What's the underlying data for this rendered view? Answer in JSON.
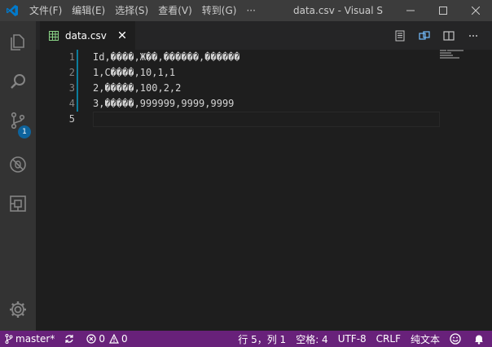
{
  "titlebar": {
    "menu": [
      "文件(F)",
      "编辑(E)",
      "选择(S)",
      "查看(V)",
      "转到(G)",
      "···"
    ],
    "title": "data.csv - Visual S",
    "controls": [
      "minimize",
      "maximize",
      "close"
    ]
  },
  "activity": {
    "items": [
      "explorer-icon",
      "search-icon",
      "source-control-icon",
      "debug-icon",
      "extensions-icon"
    ],
    "source_control_badge": "1",
    "settings": "gear-icon"
  },
  "tab": {
    "label": "data.csv",
    "icon": "csv-file-icon"
  },
  "editor": {
    "line_numbers": [
      "1",
      "2",
      "3",
      "4",
      "5"
    ],
    "lines": [
      "Id,����,Ж��,������,������",
      "1,C����,10,1,1",
      "2,�����,100,2,2",
      "3,�����,999999,9999,9999",
      ""
    ]
  },
  "statusbar": {
    "branch": "master*",
    "errors": "0",
    "warnings": "0",
    "position": "行 5，列 1",
    "indent": "空格: 4",
    "encoding": "UTF-8",
    "eol": "CRLF",
    "language": "纯文本"
  },
  "colors": {
    "statusbar": "#68217a",
    "activity": "#333333",
    "titlebar": "#3c3c3c",
    "editor_bg": "#1e1e1e",
    "badge": "#0e639c"
  }
}
